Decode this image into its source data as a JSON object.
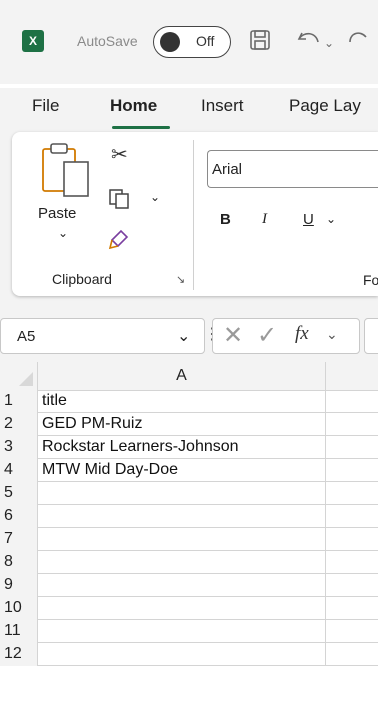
{
  "titlebar": {
    "logo_letter": "X",
    "autosave_label": "AutoSave",
    "autosave_state": "Off"
  },
  "tabs": [
    "File",
    "Home",
    "Insert",
    "Page Lay"
  ],
  "ribbon": {
    "paste_label": "Paste",
    "clipboard_label": "Clipboard",
    "font_name": "Arial",
    "bold": "B",
    "italic": "I",
    "underline": "U",
    "font_group_partial": "Fo"
  },
  "namebox": {
    "value": "A5"
  },
  "formula": {
    "fx": "fx"
  },
  "grid": {
    "column_header": "A",
    "rows": [
      {
        "num": "1",
        "a": "title"
      },
      {
        "num": "2",
        "a": "GED PM-Ruiz"
      },
      {
        "num": "3",
        "a": "Rockstar Learners-Johnson"
      },
      {
        "num": "4",
        "a": "MTW Mid Day-Doe"
      },
      {
        "num": "5",
        "a": ""
      },
      {
        "num": "6",
        "a": ""
      },
      {
        "num": "7",
        "a": ""
      },
      {
        "num": "8",
        "a": ""
      },
      {
        "num": "9",
        "a": ""
      },
      {
        "num": "10",
        "a": ""
      },
      {
        "num": "11",
        "a": ""
      },
      {
        "num": "12",
        "a": ""
      }
    ]
  },
  "colors": {
    "excel_green": "#1e7145",
    "chrome_bg": "#f3f3f3"
  }
}
